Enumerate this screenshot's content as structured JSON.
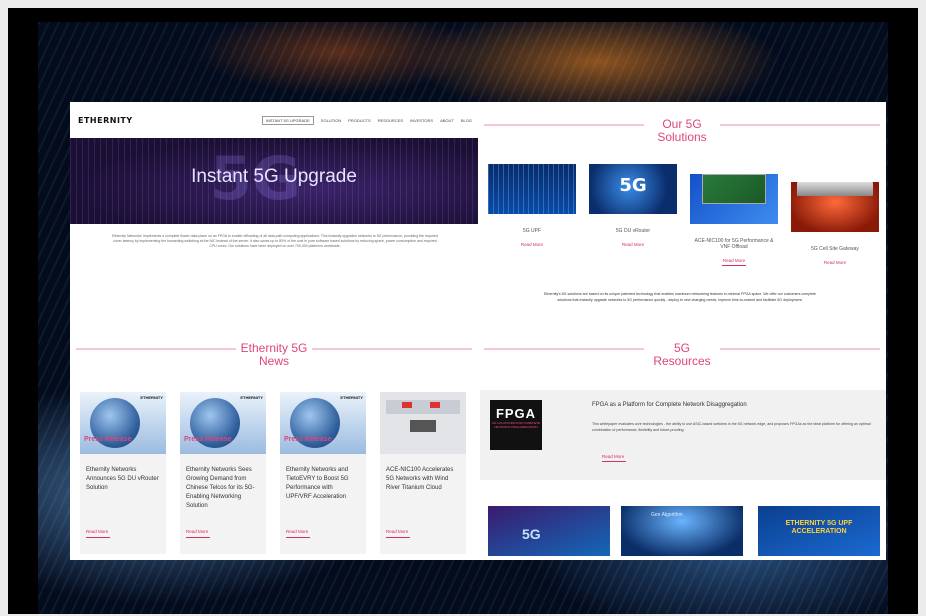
{
  "nav": {
    "logo": "ETHERNITY",
    "items": [
      "INSTANT 5G UPGRADE",
      "SOLUTION",
      "PRODUCTS",
      "RESOURCES",
      "INVESTORS",
      "ABOUT",
      "BLOG"
    ]
  },
  "hero": {
    "title": "Instant 5G Upgrade",
    "bg_text": "5G",
    "text": "Ethernity Networks' Implements a complete flower data plane on an FPGA to enable offloading of all data path computing applications. This instantly upgrades networks to 5G performance, providing the required cover latency by implementing the forwarding switching at the NIC instead of the server. It also saves up to 80% of the cost in pure software based solutions by reducing space, power consumption and required CPU cores. Our solutions have been deployed on over 700,000 platforms worldwide."
  },
  "solutions": {
    "title_line1": "Our 5G",
    "title_line2": "Solutions",
    "items": [
      {
        "label": "5G UPF",
        "read_more": "Read More"
      },
      {
        "label": "5G DU vRouter",
        "read_more": "Read More"
      },
      {
        "label": "ACE-NIC100 for 5G Performance & VNF Offload",
        "read_more": "Read More"
      },
      {
        "label": "5G Cell Site Gateway",
        "read_more": "Read More"
      }
    ],
    "text": "Ethernity's 5G solutions are based on its unique patented technology that enables maximum networking features in minimal FPGA space. We offer our customers complete solutions that instantly upgrade networks to 5G performance quickly - deploy to new charging needs, improve time-to-market and facilitate 5G deployment."
  },
  "news": {
    "title_line1": "Ethernity 5G",
    "title_line2": "News",
    "items": [
      {
        "tag": "Press Release",
        "brand": "ETHERNITY",
        "title": "Ethernity Networks Announces 5G DU vRouter Solution",
        "read_more": "Read More"
      },
      {
        "tag": "Press Release",
        "brand": "ETHERNITY",
        "title": "Ethernity Networks Sees Growing Demand from Chinese Telcos for its 5G-Enabling Networking Solution",
        "read_more": "Read More"
      },
      {
        "tag": "Press Release",
        "brand": "ETHERNITY",
        "title": "Ethernity Networks and TietoEVRY to Boost 5G Performance with UPF/VRF Acceleration",
        "read_more": "Read More"
      },
      {
        "tag": "",
        "brand": "",
        "title": "ACE-NIC100 Accelerates 5G Networks with Wind River Titanium Cloud",
        "read_more": "Read More"
      }
    ]
  },
  "resources": {
    "title_line1": "5G",
    "title_line2": "Resources",
    "thumb_big": "FPGA",
    "thumb_small": "AS A PLATFORM FOR COMPLETE NETWORK DISAGGREGATION",
    "heading": "FPGA as a Platform for Complete Network Disaggregation",
    "desc": "This whitepaper evaluates core technologies - the ability to use ASIC-based switches in the 5G network edge, and proposes FPGAs as the ideal platform for offering an optimal combination of performance, flexibility and future-proofing.",
    "read_more": "Read More",
    "videos": [
      "5G",
      "Gen Algorithm",
      "ETHERNITY 5G UPF ACCELERATION"
    ]
  }
}
